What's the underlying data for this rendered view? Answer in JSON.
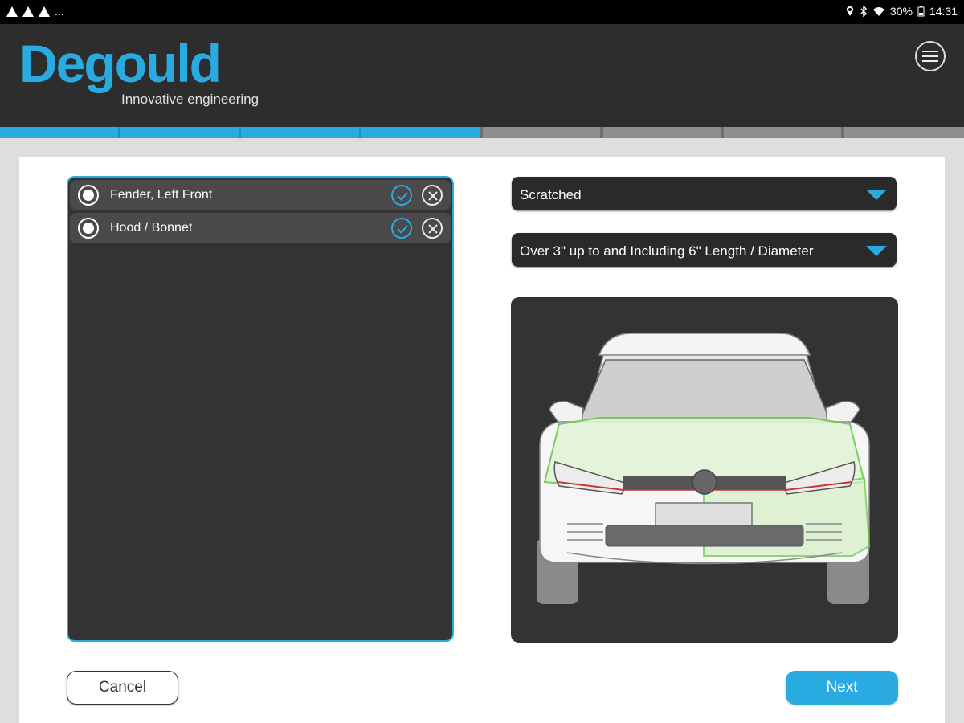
{
  "status_bar": {
    "left_icons": [
      "warning-icon",
      "warning-icon",
      "warning-icon"
    ],
    "more": "...",
    "battery": "30%",
    "time": "14:31",
    "right_icons": [
      "location-icon",
      "bluetooth-icon",
      "wifi-icon",
      "battery-icon"
    ]
  },
  "header": {
    "logo": "Degould",
    "tagline": "Innovative engineering",
    "menu_icon": "hamburger-menu-icon"
  },
  "progress": {
    "total_steps": 8,
    "completed_steps": 4
  },
  "damage_list": {
    "items": [
      {
        "label": "Fender, Left Front"
      },
      {
        "label": "Hood / Bonnet"
      }
    ]
  },
  "damage_type": {
    "selected": "Scratched"
  },
  "damage_size": {
    "selected": "Over 3\" up to and Including 6\" Length / Diameter"
  },
  "actions": {
    "cancel_label": "Cancel",
    "next_label": "Next"
  },
  "colors": {
    "accent": "#29abe2",
    "header_bg": "#2d2d2d",
    "panel_bg": "#333333",
    "highlight": "#9be07a"
  }
}
